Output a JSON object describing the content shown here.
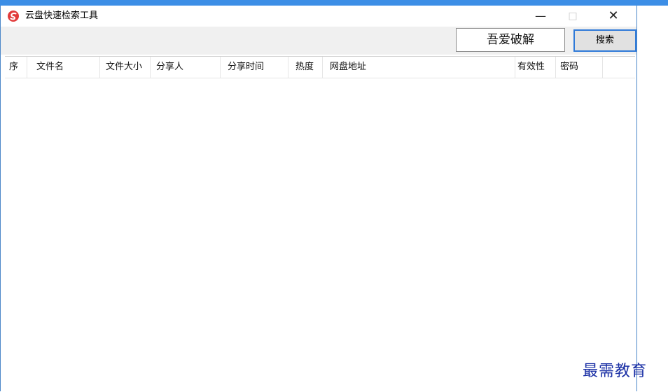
{
  "window": {
    "title": "云盘快速检索工具",
    "controls": {
      "minimize": "—",
      "maximize": "□",
      "close": "✕"
    }
  },
  "toolbar": {
    "search_value": "吾爱破解",
    "search_button_label": "搜索"
  },
  "table": {
    "columns": [
      "序",
      "文件名",
      "文件大小",
      "分享人",
      "分享时间",
      "热度",
      "网盘地址",
      "有效性",
      "密码"
    ],
    "rows": []
  },
  "watermark": "最需教育",
  "colors": {
    "accent": "#2f7ad8",
    "window_border": "#4a86c8",
    "top_strip": "#3c8ee6"
  }
}
